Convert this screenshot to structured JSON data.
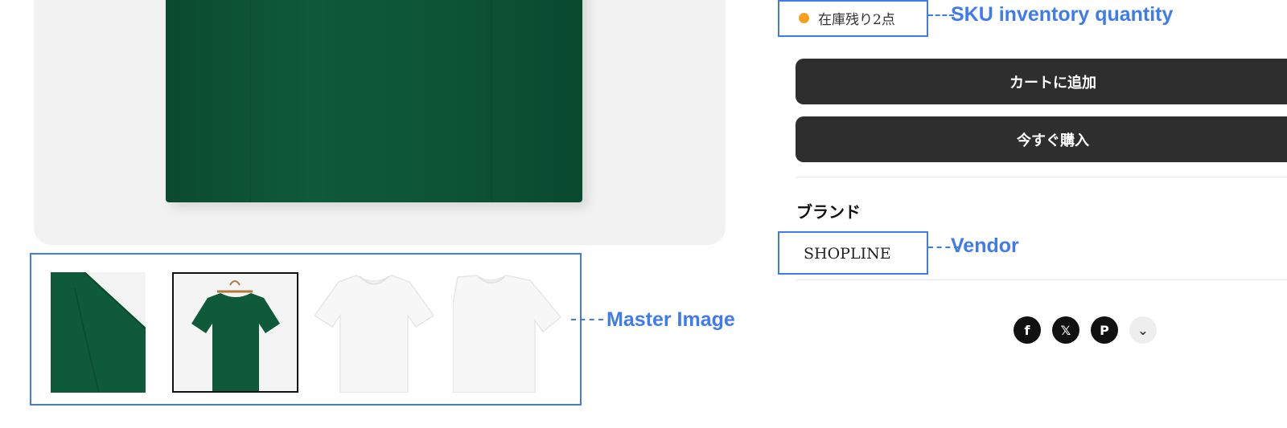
{
  "stock": {
    "text": "在庫残り2点",
    "dot_color": "#f5a11c"
  },
  "buttons": {
    "add_to_cart": "カートに追加",
    "buy_now": "今すぐ購入"
  },
  "brand": {
    "heading": "ブランド",
    "vendor": "SHOPLINE"
  },
  "thumbnails": [
    {
      "color": "green",
      "view": "sleeve-detail",
      "selected": false
    },
    {
      "color": "green",
      "view": "on-hanger",
      "selected": true
    },
    {
      "color": "white",
      "view": "front",
      "selected": false
    },
    {
      "color": "white",
      "view": "side",
      "selected": false
    }
  ],
  "share_icons": [
    "facebook-icon",
    "x-icon",
    "pinterest-icon",
    "chevron-down-icon"
  ],
  "share_glyphs": {
    "facebook": "f",
    "x": "𝕏",
    "pinterest": "P",
    "more": "⌄"
  },
  "annotations": {
    "sku": "SKU inventory quantity",
    "vendor": "Vendor",
    "master_image": "Master Image"
  },
  "colors": {
    "annotation": "#3f7bea",
    "button": "#2e2e2e",
    "shirt_green": "#0e5a3a",
    "stock_dot": "#f5a11c"
  }
}
